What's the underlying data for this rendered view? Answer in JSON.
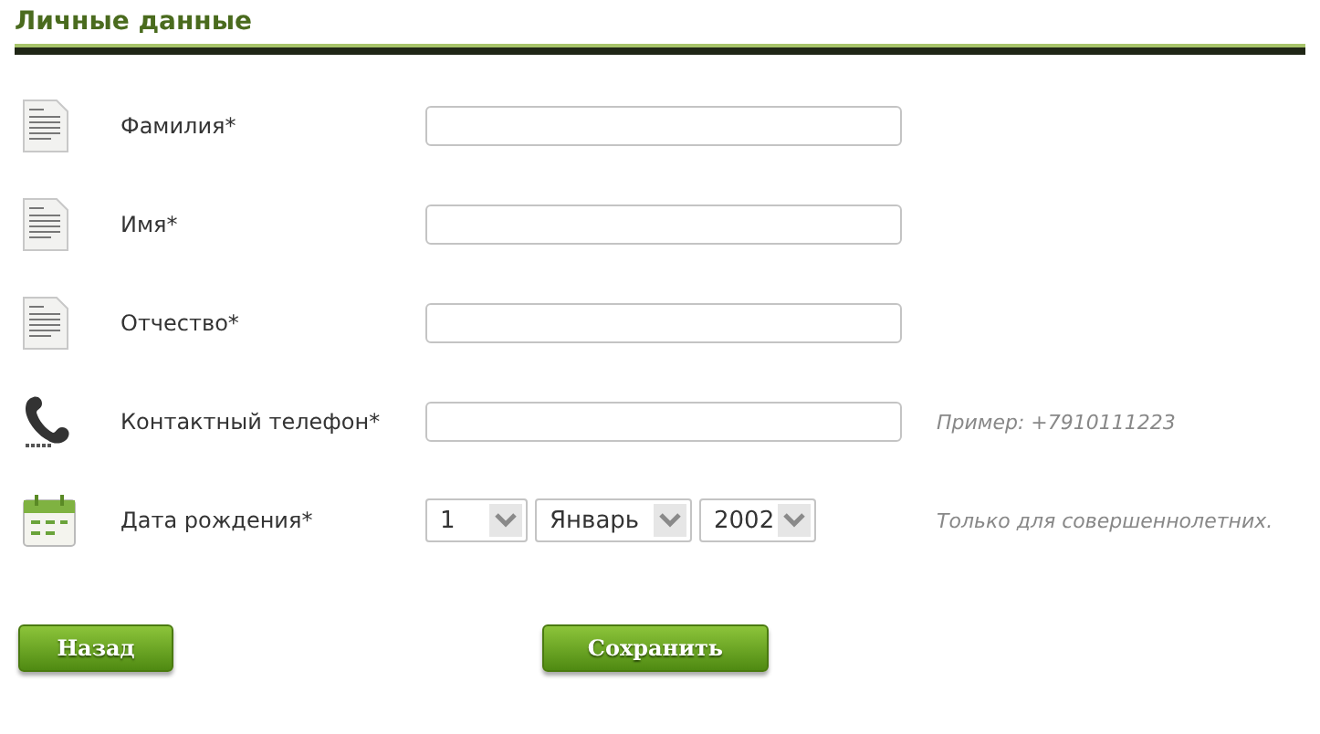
{
  "title": "Личные данные",
  "rows": [
    {
      "kind": "name",
      "label": "Фамилия*"
    },
    {
      "kind": "name",
      "label": "Имя*"
    },
    {
      "kind": "name",
      "label": "Отчество*"
    },
    {
      "kind": "phone",
      "label": "Контактный телефон*",
      "hint": "Пример: +7910111223"
    },
    {
      "kind": "date",
      "label": "Дата рождения*",
      "selects": [
        "1",
        "Январь",
        "2002"
      ],
      "hint": "Только для совершеннолетних."
    }
  ],
  "buttons": [
    "Назад",
    "Сохранить"
  ]
}
